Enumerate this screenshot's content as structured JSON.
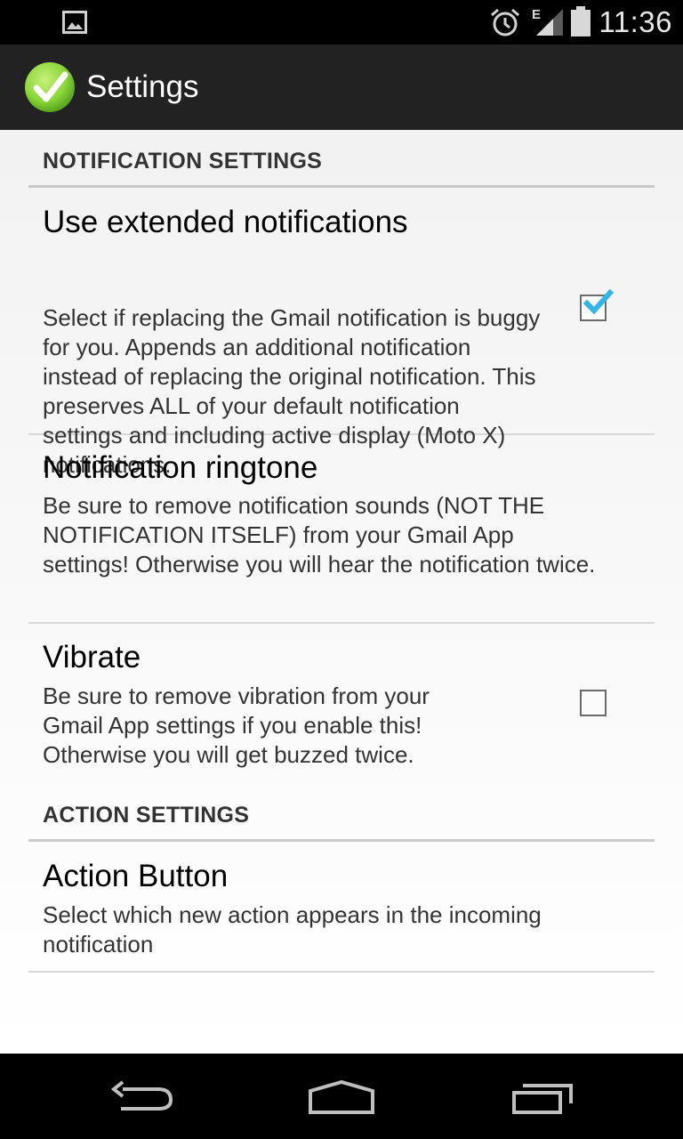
{
  "status_bar": {
    "time": "11:36",
    "network_type": "E",
    "icons": [
      "image-notification-icon",
      "alarm-icon",
      "signal-icon",
      "battery-icon"
    ]
  },
  "action_bar": {
    "title": "Settings",
    "app_icon": "green-checkmark-icon"
  },
  "sections": {
    "notification": {
      "header": "NOTIFICATION SETTINGS",
      "extended": {
        "title": "Use extended notifications",
        "summary": "Select if replacing the Gmail notification is buggy for you. Appends an additional notification instead of replacing the original notification. This preserves ALL of your default notification settings and including active display (Moto X) notifications.",
        "checked": true
      },
      "ringtone": {
        "title": "Notification ringtone",
        "summary": "Be sure to remove notification sounds (NOT THE NOTIFICATION ITSELF) from your Gmail App settings! Otherwise you will hear the notification twice."
      },
      "vibrate": {
        "title": "Vibrate",
        "summary": "Be sure to remove vibration from your Gmail App settings if you enable this! Otherwise you will get buzzed twice.",
        "checked": false
      }
    },
    "action": {
      "header": "ACTION SETTINGS",
      "action_button": {
        "title": "Action Button",
        "summary": "Select which new action appears in the incoming notification"
      }
    }
  },
  "nav_bar": {
    "icons": [
      "back-icon",
      "home-icon",
      "recent-apps-icon"
    ]
  },
  "colors": {
    "check_blue": "#33b5e5",
    "app_icon_green": "#8cd63a",
    "action_bar": "#222222"
  }
}
